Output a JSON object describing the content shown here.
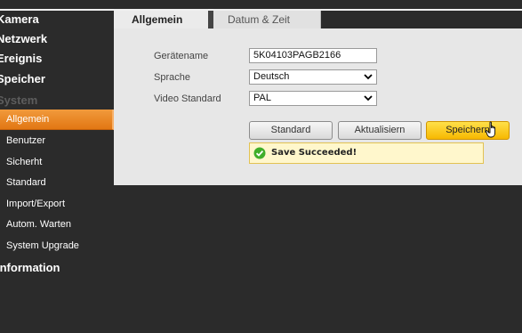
{
  "sidebar": {
    "sections": [
      "Kamera",
      "Netzwerk",
      "Ereignis",
      "Speicher",
      "System"
    ],
    "system_items": [
      "Allgemein",
      "Benutzer",
      "Sicherht",
      "Standard",
      "Import/Export",
      "Autom. Warten",
      "System Upgrade"
    ],
    "information": "Information"
  },
  "tabs": [
    "Allgemein",
    "Datum & Zeit"
  ],
  "form": {
    "device_name_label": "Gerätename",
    "device_name_value": "5K04103PAGB2166",
    "language_label": "Sprache",
    "language_value": "Deutsch",
    "video_standard_label": "Video Standard",
    "video_standard_value": "PAL"
  },
  "buttons": {
    "default": "Standard",
    "refresh": "Aktualisiern",
    "save": "Speichern"
  },
  "message": {
    "text": "Save Succeeded!",
    "icon": "check-circle-icon"
  },
  "colors": {
    "accent": "#e27713",
    "save_button": "#f7b800",
    "success": "#3fae2a"
  }
}
